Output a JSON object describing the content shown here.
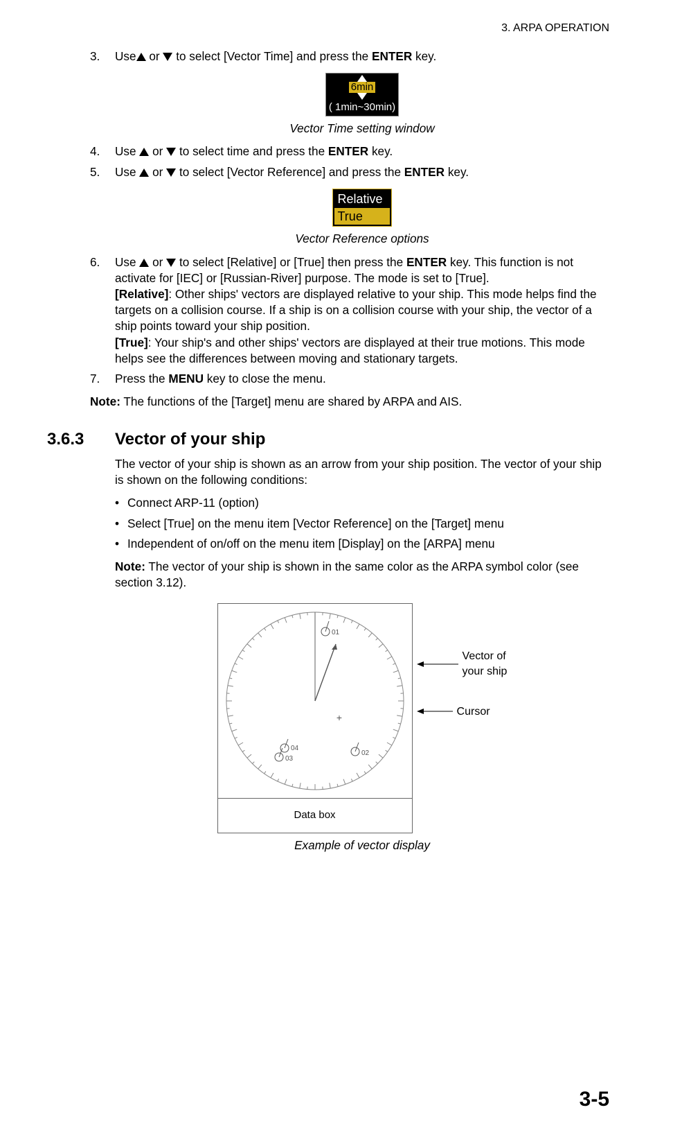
{
  "header": "3.  ARPA OPERATION",
  "page_number": "3-5",
  "steps": {
    "s3": {
      "num": "3.",
      "pre": "Use",
      "mid": " or ",
      "post": " to select [Vector Time] and press the ",
      "key": "ENTER",
      "tail": " key."
    },
    "vector_time_window": {
      "value": "6min",
      "range": "( 1min~30min)"
    },
    "caption_vt": "Vector Time setting window",
    "s4": {
      "num": "4.",
      "pre": "Use ",
      "mid": " or ",
      "post": " to select time and press the ",
      "key": "ENTER",
      "tail": " key."
    },
    "s5": {
      "num": "5.",
      "pre": "Use ",
      "mid": " or ",
      "post": " to select [Vector Reference] and press the ",
      "key": "ENTER",
      "tail": " key."
    },
    "vector_ref_window": {
      "opt1": "Relative",
      "opt2": "True"
    },
    "caption_vr": "Vector Reference options",
    "s6": {
      "num": "6.",
      "pre": "Use ",
      "mid": " or ",
      "post": " to select [Relative] or [True] then press the ",
      "key": "ENTER",
      "tail": " key. This function is not activate for [IEC] or [Russian-River] purpose. The mode is set to [True].",
      "rel_label": "[Relative]",
      "rel_text": ": Other ships' vectors are displayed relative to your ship. This mode helps find the targets on a collision course. If a ship is on a collision course with your ship, the vector of a ship points toward your ship position.",
      "true_label": "[True]",
      "true_text": ": Your ship's and other ships' vectors are displayed at their true motions. This mode helps see the differences between moving and stationary targets."
    },
    "s7": {
      "num": "7.",
      "pre": "Press the ",
      "key": "MENU",
      "tail": " key to close the menu."
    }
  },
  "note1": {
    "label": "Note:",
    "text": " The functions of the [Target] menu are shared by ARPA and AIS."
  },
  "section": {
    "num": "3.6.3",
    "title": "Vector of your ship",
    "intro": "The vector of your ship is shown as an arrow from your ship position. The vector of your ship is shown on the following conditions:",
    "bullets": [
      "Connect ARP-11 (option)",
      "Select [True] on the menu item [Vector Reference] on the [Target] menu",
      "Independent of on/off on the menu item [Display] on the [ARPA] menu"
    ],
    "note": {
      "label": "Note:",
      "text": " The vector of your ship is shown in the same color as the ARPA symbol color (see section 3.12)."
    }
  },
  "figure": {
    "targets": {
      "t1": "01",
      "t2": "02",
      "t3": "03",
      "t4": "04"
    },
    "databox": "Data box",
    "callout_vector_l1": "Vector of",
    "callout_vector_l2": "your ship",
    "callout_cursor": "Cursor",
    "caption": "Example of vector display"
  }
}
